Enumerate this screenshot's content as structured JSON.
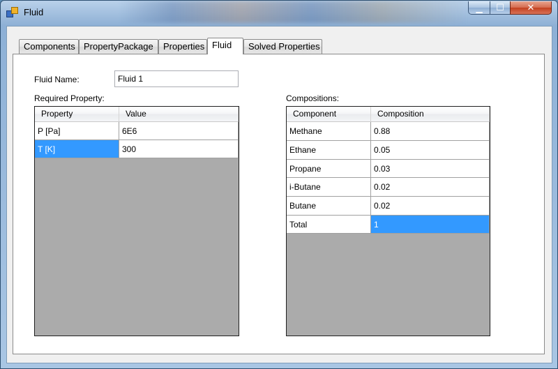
{
  "window": {
    "title": "Fluid"
  },
  "tabs": [
    {
      "label": "Components"
    },
    {
      "label": "PropertyPackage"
    },
    {
      "label": "Properties"
    },
    {
      "label": "Fluid"
    },
    {
      "label": "Solved Properties"
    }
  ],
  "active_tab": "Fluid",
  "fluid_name": {
    "label": "Fluid Name:",
    "value": "Fluid 1"
  },
  "required": {
    "label": "Required Property:",
    "headers": [
      "Property",
      "Value"
    ],
    "rows": [
      {
        "property": "P [Pa]",
        "value": "6E6"
      },
      {
        "property": "T [K]",
        "value": "300"
      }
    ]
  },
  "compositions": {
    "label": "Compositions:",
    "headers": [
      "Component",
      "Composition"
    ],
    "rows": [
      {
        "component": "Methane",
        "composition": "0.88"
      },
      {
        "component": "Ethane",
        "composition": "0.05"
      },
      {
        "component": "Propane",
        "composition": "0.03"
      },
      {
        "component": "i-Butane",
        "composition": "0.02"
      },
      {
        "component": "Butane",
        "composition": "0.02"
      },
      {
        "component": "Total",
        "composition": "1"
      }
    ]
  },
  "colors": {
    "selection": "#3399ff",
    "grid_background": "#ababab",
    "close_button": "#c3401f"
  },
  "icons": {
    "app": "app-icon",
    "minimize": "minimize-icon",
    "maximize": "maximize-icon",
    "close": "close-icon"
  }
}
